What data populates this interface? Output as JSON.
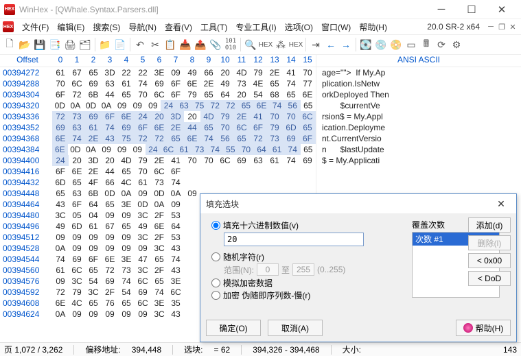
{
  "window": {
    "title": "WinHex - [QWhale.Syntax.Parsers.dll]"
  },
  "menu": {
    "items": [
      "文件(F)",
      "编辑(E)",
      "搜索(S)",
      "导航(N)",
      "查看(V)",
      "工具(T)",
      "专业工具(I)",
      "选项(O)",
      "窗口(W)",
      "帮助(H)"
    ],
    "version": "20.0 SR-2 x64"
  },
  "header": {
    "offset": "Offset",
    "cols": [
      "0",
      "1",
      "2",
      "3",
      "4",
      "5",
      "6",
      "7",
      "8",
      "9",
      "10",
      "11",
      "12",
      "13",
      "14",
      "15"
    ],
    "ascii": "ANSI ASCII"
  },
  "rows": [
    {
      "off": "00394272",
      "b": [
        "61",
        "67",
        "65",
        "3D",
        "22",
        "22",
        "3E",
        "09",
        "49",
        "66",
        "20",
        "4D",
        "79",
        "2E",
        "41",
        "70"
      ],
      "s": [
        0,
        0,
        0,
        0,
        0,
        0,
        0,
        0,
        0,
        0,
        0,
        0,
        0,
        0,
        0,
        0
      ],
      "a": "age=\"\">  If My.Ap"
    },
    {
      "off": "00394288",
      "b": [
        "70",
        "6C",
        "69",
        "63",
        "61",
        "74",
        "69",
        "6F",
        "6E",
        "2E",
        "49",
        "73",
        "4E",
        "65",
        "74",
        "77"
      ],
      "s": [
        0,
        0,
        0,
        0,
        0,
        0,
        0,
        0,
        0,
        0,
        0,
        0,
        0,
        0,
        0,
        0
      ],
      "a": "plication.IsNetw"
    },
    {
      "off": "00394304",
      "b": [
        "6F",
        "72",
        "6B",
        "44",
        "65",
        "70",
        "6C",
        "6F",
        "79",
        "65",
        "64",
        "20",
        "54",
        "68",
        "65",
        "6E"
      ],
      "s": [
        0,
        0,
        0,
        0,
        0,
        0,
        0,
        0,
        0,
        0,
        0,
        0,
        0,
        0,
        0,
        0
      ],
      "a": "orkDeployed Then"
    },
    {
      "off": "00394320",
      "b": [
        "0D",
        "0A",
        "0D",
        "0A",
        "09",
        "09",
        "09",
        "24",
        "63",
        "75",
        "72",
        "72",
        "65",
        "6E",
        "74",
        "56",
        "65"
      ],
      "s": [
        0,
        0,
        0,
        0,
        0,
        0,
        0,
        1,
        1,
        1,
        1,
        1,
        1,
        1,
        1,
        1
      ],
      "a": "        $currentVe"
    },
    {
      "off": "00394336",
      "b": [
        "72",
        "73",
        "69",
        "6F",
        "6E",
        "24",
        "20",
        "3D",
        "20",
        "4D",
        "79",
        "2E",
        "41",
        "70",
        "70",
        "6C"
      ],
      "s": [
        1,
        1,
        1,
        1,
        1,
        1,
        1,
        1,
        0,
        1,
        1,
        1,
        1,
        1,
        1,
        1
      ],
      "a": "rsion$ = My.Appl"
    },
    {
      "off": "00394352",
      "b": [
        "69",
        "63",
        "61",
        "74",
        "69",
        "6F",
        "6E",
        "2E",
        "44",
        "65",
        "70",
        "6C",
        "6F",
        "79",
        "6D",
        "65"
      ],
      "s": [
        1,
        1,
        1,
        1,
        1,
        1,
        1,
        1,
        1,
        1,
        1,
        1,
        1,
        1,
        1,
        1
      ],
      "a": "ication.Deployme"
    },
    {
      "off": "00394368",
      "b": [
        "6E",
        "74",
        "2E",
        "43",
        "75",
        "72",
        "72",
        "65",
        "6E",
        "74",
        "56",
        "65",
        "72",
        "73",
        "69",
        "6F"
      ],
      "s": [
        1,
        1,
        1,
        1,
        1,
        1,
        1,
        1,
        1,
        1,
        1,
        1,
        1,
        1,
        1,
        1
      ],
      "a": "nt.CurrentVersio"
    },
    {
      "off": "00394384",
      "b": [
        "6E",
        "0D",
        "0A",
        "09",
        "09",
        "09",
        "24",
        "6C",
        "61",
        "73",
        "74",
        "55",
        "70",
        "64",
        "61",
        "74",
        "65"
      ],
      "s": [
        1,
        0,
        0,
        0,
        0,
        0,
        1,
        1,
        1,
        1,
        1,
        1,
        1,
        1,
        1,
        1
      ],
      "a": "n      $lastUpdate"
    },
    {
      "off": "00394400",
      "b": [
        "24",
        "20",
        "3D",
        "20",
        "4D",
        "79",
        "2E",
        "41",
        "70",
        "70",
        "6C",
        "69",
        "63",
        "61",
        "74",
        "69"
      ],
      "s": [
        1,
        0,
        0,
        0,
        0,
        0,
        0,
        0,
        0,
        0,
        0,
        0,
        0,
        0,
        0,
        0
      ],
      "a": "$ = My.Applicati"
    },
    {
      "off": "00394416",
      "b": [
        "6F",
        "6E",
        "2E",
        "44",
        "65",
        "70",
        "6C",
        "6F",
        "",
        ""
      ],
      "s": [
        0,
        0,
        0,
        0,
        0,
        0,
        0,
        0,
        0,
        0
      ],
      "a": ""
    },
    {
      "off": "00394432",
      "b": [
        "6D",
        "65",
        "4F",
        "66",
        "4C",
        "61",
        "73",
        "74",
        "",
        ""
      ],
      "s": [
        0,
        0,
        0,
        0,
        0,
        0,
        0,
        0,
        0,
        0
      ],
      "a": ""
    },
    {
      "off": "00394448",
      "b": [
        "65",
        "63",
        "6B",
        "0D",
        "0A",
        "09",
        "0D",
        "0A",
        "09",
        "",
        ""
      ],
      "s": [
        0,
        0,
        0,
        0,
        0,
        0,
        0,
        0,
        0,
        0,
        0
      ],
      "a": ""
    },
    {
      "off": "00394464",
      "b": [
        "43",
        "6F",
        "64",
        "65",
        "3E",
        "0D",
        "0A",
        "09",
        "",
        ""
      ],
      "s": [
        0,
        0,
        0,
        0,
        0,
        0,
        0,
        0,
        0,
        0
      ],
      "a": ""
    },
    {
      "off": "00394480",
      "b": [
        "3C",
        "05",
        "04",
        "09",
        "09",
        "3C",
        "2F",
        "53",
        "",
        ""
      ],
      "s": [
        0,
        0,
        0,
        0,
        0,
        0,
        0,
        0,
        0,
        0
      ],
      "a": ""
    },
    {
      "off": "00394496",
      "b": [
        "49",
        "6D",
        "61",
        "67",
        "65",
        "49",
        "6E",
        "64",
        "",
        ""
      ],
      "s": [
        0,
        0,
        0,
        0,
        0,
        0,
        0,
        0,
        0,
        0
      ],
      "a": ""
    },
    {
      "off": "00394512",
      "b": [
        "09",
        "09",
        "09",
        "09",
        "09",
        "3C",
        "2F",
        "53",
        "",
        ""
      ],
      "s": [
        0,
        0,
        0,
        0,
        0,
        0,
        0,
        0,
        0,
        0
      ],
      "a": ""
    },
    {
      "off": "00394528",
      "b": [
        "0A",
        "09",
        "09",
        "09",
        "09",
        "09",
        "3C",
        "43",
        "",
        ""
      ],
      "s": [
        0,
        0,
        0,
        0,
        0,
        0,
        0,
        0,
        0,
        0
      ],
      "a": ""
    },
    {
      "off": "00394544",
      "b": [
        "74",
        "69",
        "6F",
        "6E",
        "3E",
        "47",
        "65",
        "74",
        "",
        ""
      ],
      "s": [
        0,
        0,
        0,
        0,
        0,
        0,
        0,
        0,
        0,
        0
      ],
      "a": ""
    },
    {
      "off": "00394560",
      "b": [
        "61",
        "6C",
        "65",
        "72",
        "73",
        "3C",
        "2F",
        "43",
        "",
        ""
      ],
      "s": [
        0,
        0,
        0,
        0,
        0,
        0,
        0,
        0,
        0,
        0
      ],
      "a": ""
    },
    {
      "off": "00394576",
      "b": [
        "09",
        "3C",
        "54",
        "69",
        "74",
        "6C",
        "65",
        "3E",
        "",
        ""
      ],
      "s": [
        0,
        0,
        0,
        0,
        0,
        0,
        0,
        0,
        0,
        0
      ],
      "a": ""
    },
    {
      "off": "00394592",
      "b": [
        "72",
        "79",
        "3C",
        "2F",
        "54",
        "69",
        "74",
        "6C",
        "",
        ""
      ],
      "s": [
        0,
        0,
        0,
        0,
        0,
        0,
        0,
        0,
        0,
        0
      ],
      "a": ""
    },
    {
      "off": "00394608",
      "b": [
        "6E",
        "4C",
        "65",
        "76",
        "65",
        "6C",
        "3E",
        "35",
        "",
        ""
      ],
      "s": [
        0,
        0,
        0,
        0,
        0,
        0,
        0,
        0,
        0,
        0
      ],
      "a": ""
    },
    {
      "off": "00394624",
      "b": [
        "0A",
        "09",
        "09",
        "09",
        "09",
        "09",
        "3C",
        "43",
        "",
        ""
      ],
      "s": [
        0,
        0,
        0,
        0,
        0,
        0,
        0,
        0,
        0,
        0
      ],
      "a": ""
    }
  ],
  "status": {
    "page": "页 1,072 / 3,262",
    "offLabel": "偏移地址:",
    "off": "394,448",
    "selLabel": "选块:",
    "sel": "= 62",
    "range": "394,326 - 394,468",
    "sizeLabel": "大小:",
    "size": "143"
  },
  "dialog": {
    "title": "填充选块",
    "optHex": "填充十六进制数值(v)",
    "hexValue": "20",
    "optRandom": "随机字符(r)",
    "rangeLabel": "范围(N):",
    "rangeFrom": "0",
    "rangeTo": "至",
    "rangeMax": "255",
    "rangeHint": "(0..255)",
    "optSim": "模拟加密数据",
    "optEnc": "加密 伪随即序列数-慢(r)",
    "passesLabel": "覆盖次数",
    "passItem": "次数 #1",
    "btnAdd": "添加(d)",
    "btnDel": "删除(l)",
    "btn00": "< 0x00",
    "btnDoD": "< DoD",
    "btnOK": "确定(O)",
    "btnCancel": "取消(A)",
    "btnHelp": "帮助(H)"
  }
}
